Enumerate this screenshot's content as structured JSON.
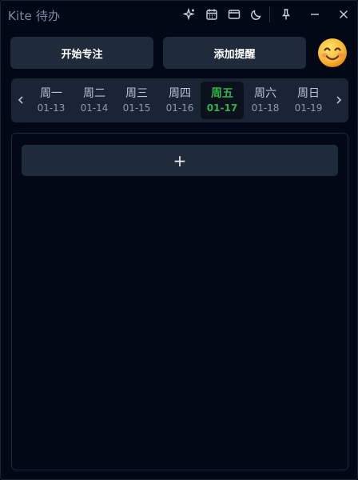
{
  "app": {
    "title": "Kite 待办"
  },
  "titlebar": {
    "icons": [
      "sparkle-icon",
      "calendar-icon",
      "window-icon",
      "moon-icon",
      "pin-icon",
      "minimize-icon",
      "close-icon"
    ]
  },
  "actions": {
    "start_focus_label": "开始专注",
    "add_reminder_label": "添加提醒",
    "emoji": "smiling-face"
  },
  "week": {
    "days": [
      {
        "weekday": "周一",
        "date": "01-13",
        "active": false
      },
      {
        "weekday": "周二",
        "date": "01-14",
        "active": false
      },
      {
        "weekday": "周三",
        "date": "01-15",
        "active": false
      },
      {
        "weekday": "周四",
        "date": "01-16",
        "active": false
      },
      {
        "weekday": "周五",
        "date": "01-17",
        "active": true
      },
      {
        "weekday": "周六",
        "date": "01-18",
        "active": false
      },
      {
        "weekday": "周日",
        "date": "01-19",
        "active": false
      }
    ]
  },
  "tasks": {
    "add_label": "+"
  },
  "colors": {
    "background": "#020816",
    "button": "#1f2a3b",
    "accent": "#33b24a",
    "strip": "#1a2434"
  }
}
